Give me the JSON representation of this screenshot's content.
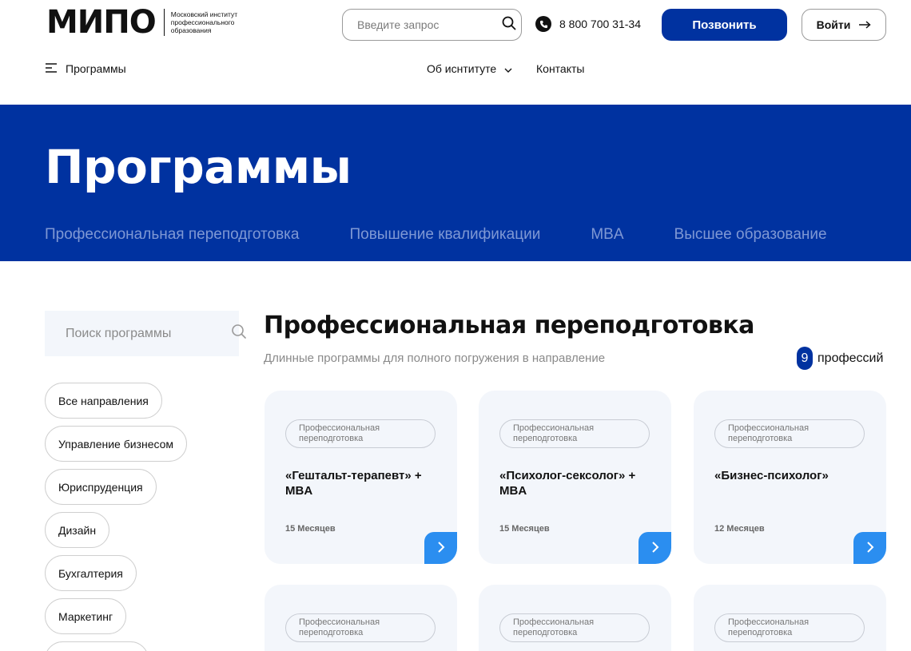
{
  "header": {
    "logo_mark": "МИПО",
    "logo_text": "Московский институт профессионального образования",
    "search_placeholder": "Введите запрос",
    "phone": "8 800 700 31-34",
    "call_label": "Позвонить",
    "login_label": "Войти",
    "nav": {
      "programs": "Программы",
      "about": "Об иснтитуте",
      "contacts": "Контакты"
    }
  },
  "hero": {
    "title": "Программы",
    "tabs": [
      "Профессиональная переподготовка",
      "Повышение квалификации",
      "MBA",
      "Высшее образование"
    ]
  },
  "sidebar": {
    "search_placeholder": "Поиск программы",
    "chips": [
      "Все направления",
      "Управление бизнесом",
      "Юриспруденция",
      "Дизайн",
      "Бухгалтерия",
      "Маркетинг"
    ]
  },
  "main": {
    "title": "Профессиональная переподготовка",
    "subtitle": "Длинные программы для полного погружения в направление",
    "count": "9",
    "count_label": "профессий",
    "cards": [
      {
        "tag": "Профессиональная переподготовка",
        "title": "«Гештальт-терапевт» + MBA",
        "duration": "15 Месяцев"
      },
      {
        "tag": "Профессиональная переподготовка",
        "title": "«Психолог-сексолог» + MBA",
        "duration": "15 Месяцев"
      },
      {
        "tag": "Профессиональная переподготовка",
        "title": "«Бизнес-психолог»",
        "duration": "12 Месяцев"
      },
      {
        "tag": "Профессиональная переподготовка"
      },
      {
        "tag": "Профессиональная переподготовка"
      },
      {
        "tag": "Профессиональная переподготовка"
      }
    ]
  },
  "colors": {
    "brand_blue": "#0032a0",
    "accent_blue": "#2b8ef0",
    "card_bg": "#f3f6fb"
  }
}
